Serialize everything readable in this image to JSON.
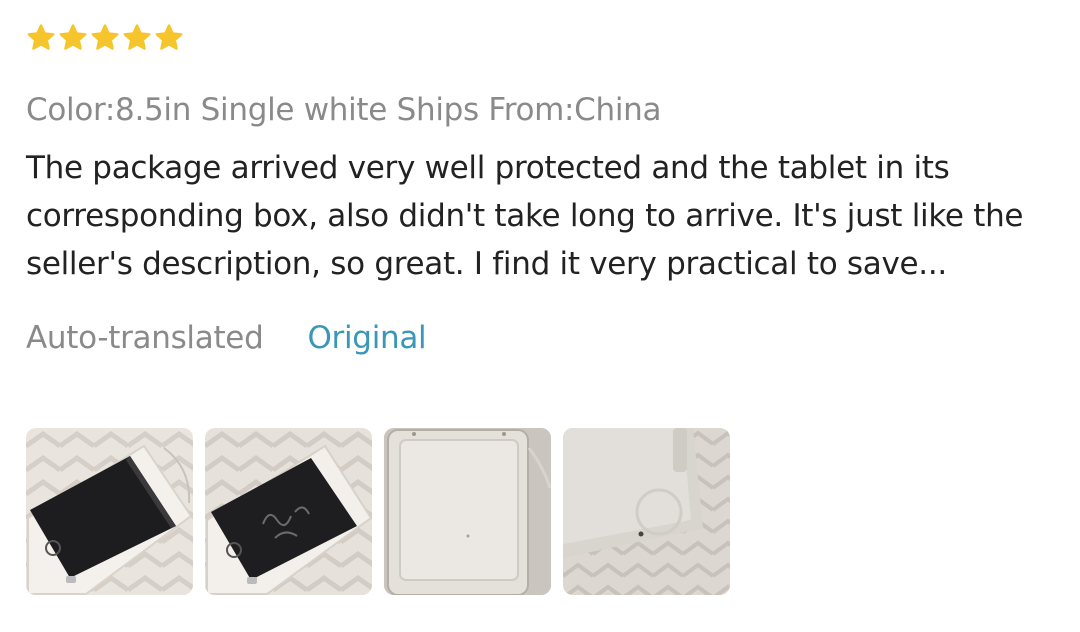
{
  "review": {
    "rating": 5,
    "star_color": "#f5c52b",
    "sku_text": "Color:8.5in Single white Ships From:China",
    "body_text": "The package arrived very well protected and the tablet in its corresponding box, also didn't take long to arrive. It's just like the seller's description, so great. I find it very practical to save...",
    "translation": {
      "auto_label": "Auto-translated",
      "original_label": "Original",
      "link_color": "#3a97b8"
    },
    "photos": [
      {
        "icon": "photo-tablet-dark-screen"
      },
      {
        "icon": "photo-tablet-written-screen"
      },
      {
        "icon": "photo-tablet-back-white"
      },
      {
        "icon": "photo-tablet-corner-closeup"
      }
    ]
  }
}
